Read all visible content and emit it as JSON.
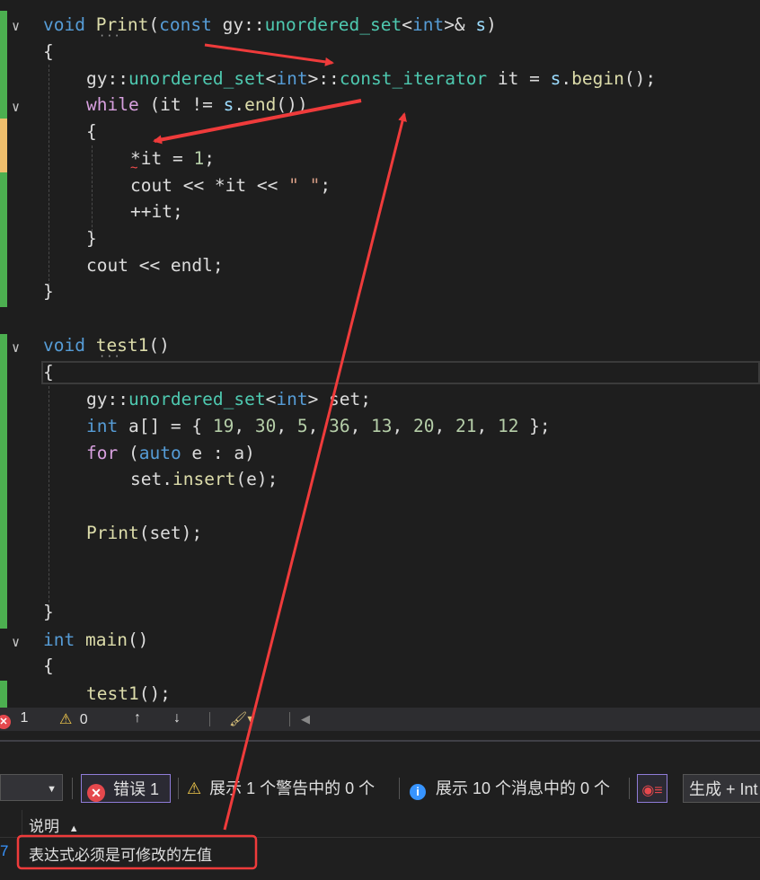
{
  "editor": {
    "lines": [
      [
        [
          "kw",
          "void "
        ],
        [
          "fn",
          "Print"
        ],
        [
          "tx",
          "("
        ],
        [
          "kw",
          "const "
        ],
        [
          "tx",
          "gy::"
        ],
        [
          "ty",
          "unordered_set"
        ],
        [
          "tx",
          "<"
        ],
        [
          "kw",
          "int"
        ],
        [
          "tx",
          ">& "
        ],
        [
          "pm",
          "s"
        ],
        [
          "tx",
          ")"
        ]
      ],
      [
        [
          "tx",
          "{"
        ]
      ],
      [
        [
          "tx",
          "gy::"
        ],
        [
          "ty",
          "unordered_set"
        ],
        [
          "tx",
          "<"
        ],
        [
          "kw",
          "int"
        ],
        [
          "tx",
          ">::"
        ],
        [
          "ty",
          "const_iterator"
        ],
        [
          "tx",
          " it = "
        ],
        [
          "pm",
          "s"
        ],
        [
          "tx",
          "."
        ],
        [
          "fn",
          "begin"
        ],
        [
          "tx",
          "();"
        ]
      ],
      [
        [
          "ky",
          "while"
        ],
        [
          "tx",
          " (it != "
        ],
        [
          "pm",
          "s"
        ],
        [
          "tx",
          "."
        ],
        [
          "fn",
          "end"
        ],
        [
          "tx",
          "())"
        ]
      ],
      [
        [
          "tx",
          "{"
        ]
      ],
      [
        [
          "tx",
          "*it = "
        ],
        [
          "nm",
          "1"
        ],
        [
          "tx",
          ";"
        ]
      ],
      [
        [
          "tx",
          "cout << *it << "
        ],
        [
          "st",
          "\" \""
        ],
        [
          "tx",
          ";"
        ]
      ],
      [
        [
          "tx",
          "++it;"
        ]
      ],
      [
        [
          "tx",
          "}"
        ]
      ],
      [
        [
          "tx",
          "cout << endl;"
        ]
      ],
      [
        [
          "tx",
          "}"
        ]
      ],
      [
        [
          "kw",
          "void "
        ],
        [
          "fn",
          "test1"
        ],
        [
          "tx",
          "()"
        ]
      ],
      [
        [
          "tx",
          "{"
        ]
      ],
      [
        [
          "tx",
          "gy::"
        ],
        [
          "ty",
          "unordered_set"
        ],
        [
          "tx",
          "<"
        ],
        [
          "kw",
          "int"
        ],
        [
          "tx",
          "> set;"
        ]
      ],
      [
        [
          "kw",
          "int"
        ],
        [
          "tx",
          " a[] = { "
        ],
        [
          "nm",
          "19"
        ],
        [
          "tx",
          ", "
        ],
        [
          "nm",
          "30"
        ],
        [
          "tx",
          ", "
        ],
        [
          "nm",
          "5"
        ],
        [
          "tx",
          ", "
        ],
        [
          "nm",
          "36"
        ],
        [
          "tx",
          ", "
        ],
        [
          "nm",
          "13"
        ],
        [
          "tx",
          ", "
        ],
        [
          "nm",
          "20"
        ],
        [
          "tx",
          ", "
        ],
        [
          "nm",
          "21"
        ],
        [
          "tx",
          ", "
        ],
        [
          "nm",
          "12"
        ],
        [
          "tx",
          " };"
        ]
      ],
      [
        [
          "ky",
          "for"
        ],
        [
          "tx",
          " ("
        ],
        [
          "kw",
          "auto"
        ],
        [
          "tx",
          " e : a)"
        ]
      ],
      [
        [
          "tx",
          "set."
        ],
        [
          "fn",
          "insert"
        ],
        [
          "tx",
          "(e);"
        ]
      ],
      [
        [
          "fn",
          "Print"
        ],
        [
          "tx",
          "(set);"
        ]
      ],
      [
        [
          "tx",
          "}"
        ]
      ],
      [
        [
          "kw",
          "int "
        ],
        [
          "fn",
          "main"
        ],
        [
          "tx",
          "()"
        ]
      ],
      [
        [
          "tx",
          "{"
        ]
      ],
      [
        [
          "fn",
          "test1"
        ],
        [
          "tx",
          "();"
        ]
      ]
    ]
  },
  "status": {
    "errors": "1",
    "warnings": "0"
  },
  "error_list": {
    "scope_value": "",
    "errors_label": "错误 1",
    "warnings_label": "展示 1 个警告中的 0 个",
    "messages_label": "展示 10 个消息中的 0 个",
    "build_filter": "生成 + Int",
    "col_description": "说明",
    "row_line": "7",
    "row_description": "表达式必须是可修改的左值"
  }
}
